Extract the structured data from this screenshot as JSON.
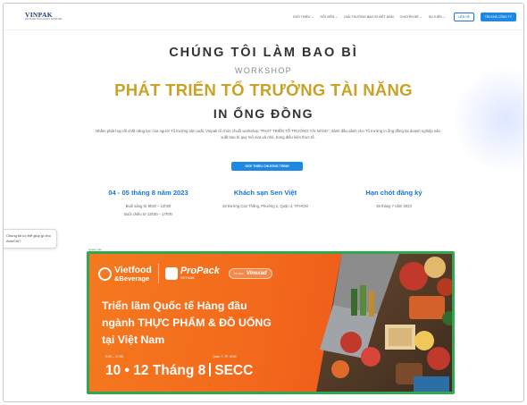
{
  "header": {
    "logo_brand": "VINPAK",
    "logo_sub": "WE MAKE PACKAGING SMARTER",
    "nav": [
      "GIỚI THIỆU ⌄",
      "HỘI VIÊN ⌄",
      "GIẢI THƯỞNG BAO BÌ VIỆT NAM",
      "CHUYÊN ĐỀ ⌄",
      "SỰ KIỆN ⌄"
    ],
    "contact_label": "LIÊN HỆ",
    "register_label": "TÌM KHÁ CÔNG TÝ"
  },
  "hero": {
    "title": "CHÚNG TÔI LÀM BAO BÌ",
    "kicker": "WORKSHOP",
    "headline": "PHÁT TRIỂN TỔ TRƯỞNG TÀI NĂNG",
    "subline": "IN ỐNG ĐỒNG",
    "description": "Nhằm phát huy tối chất năng lực của người Tổ trưởng sản xuất, Vinpak tổ chức chuỗi workshop \"PHÁT TRIỂN TỔ TRƯỞNG TÀI NĂNG\", dành đầu dành cho Tổ trưởng in ống đồng tại doanh nghiệp sản xuất bao bì quy mô vừa và nhỏ, trong điều kiện thực tế.",
    "cta_label": "GIỚI THIỆU CHƯƠNG TRÌNH"
  },
  "info": [
    {
      "title": "04 - 05 tháng 8 năm 2023",
      "lines": [
        "Buổi sáng từ 8h30 – 12h00",
        "Buổi chiều từ 13h30 – 17h00"
      ]
    },
    {
      "title": "Khách sạn Sen Việt",
      "lines": [
        "33 Đường Cao Thắng, Phường 2, Quận 3, TP.HCM"
      ]
    },
    {
      "title": "Hạn chót đăng ký",
      "lines": [
        "28 tháng 7 năm 2023"
      ]
    }
  ],
  "chat": {
    "text": "Chúng tôi có thể giúp gì cho Anh/Chị?"
  },
  "banner": {
    "label": "Quảng cáo",
    "logo1_a": "Vietfood",
    "logo1_b": "&Beverage",
    "logo2_a": "ProPack",
    "logo2_b": "VIETNAM",
    "partner_small": "Tổ chức",
    "partner_name": "Vinexad",
    "headline_1": "Triển lãm Quốc tế Hàng đầu",
    "headline_2": "ngành THỰC PHẨM & ĐỒ UỐNG",
    "headline_3": "tại Việt Nam",
    "time": "9:00 – 17:00",
    "location_top": "Quận 7, TP. HCM",
    "date": "10 • 12 Tháng 8",
    "venue": "SECC"
  },
  "colors": {
    "accent_blue": "#1e88e5",
    "gold": "#c9a227",
    "banner_orange": "#f36a1c",
    "banner_border": "#2fa84f"
  }
}
